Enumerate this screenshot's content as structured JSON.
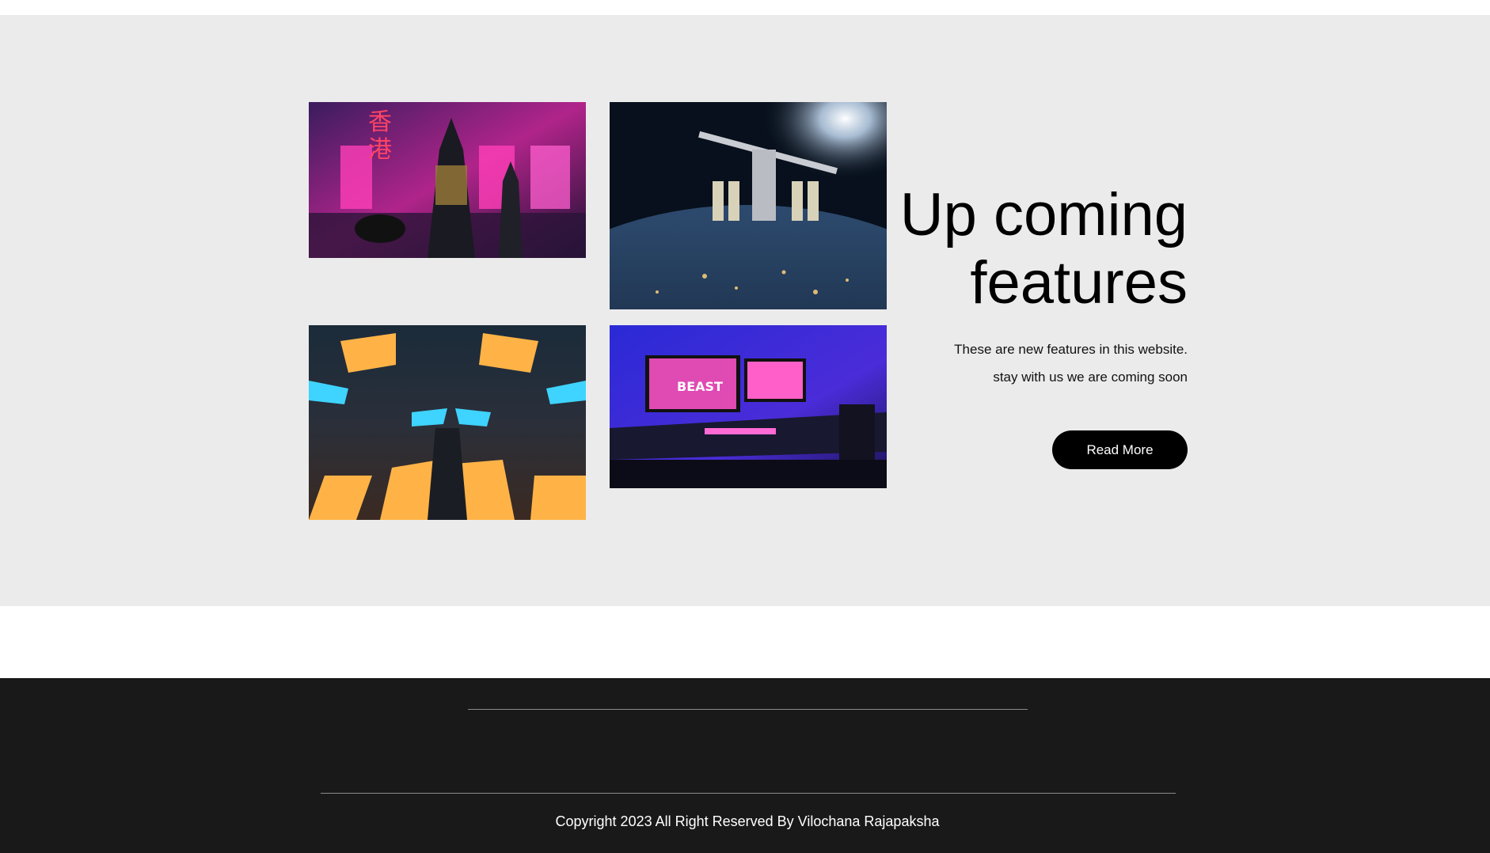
{
  "features": {
    "heading_line1": "Up coming",
    "heading_line2": "features",
    "desc_line1": "These are new features in this website.",
    "desc_line2": "stay with us we are coming soon",
    "read_more_label": "Read More"
  },
  "images": [
    {
      "name": "cyberpunk-city-image",
      "overlay_text": "香港"
    },
    {
      "name": "space-station-image"
    },
    {
      "name": "neon-cubes-image"
    },
    {
      "name": "gaming-setup-image",
      "overlay_text": "BEAST"
    }
  ],
  "footer": {
    "copyright": "Copyright 2023 All Right Reserved By Vilochana Rajapaksha"
  },
  "colors": {
    "section_bg": "#ebebeb",
    "footer_bg": "#191919",
    "button_bg": "#000000",
    "button_text": "#ffffff"
  }
}
